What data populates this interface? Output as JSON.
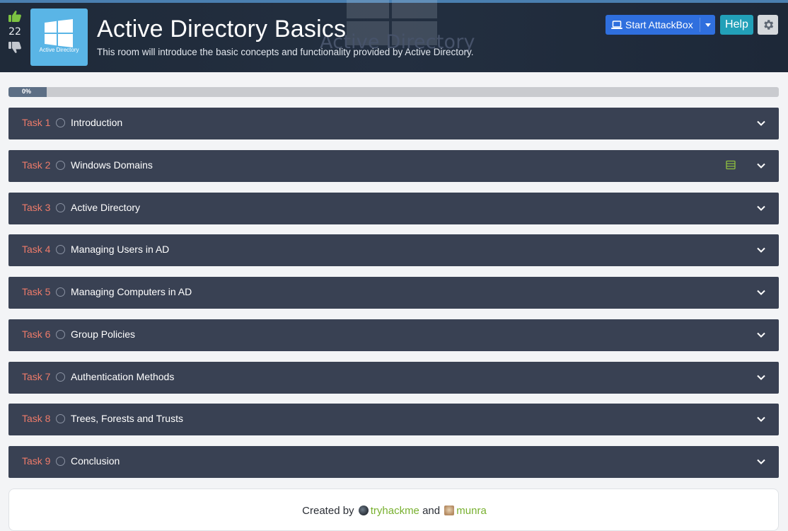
{
  "header": {
    "title": "Active Directory Basics",
    "subtitle": "This room will introduce the basic concepts and functionality provided by Active Directory.",
    "background_text": "Active Directory",
    "vote_count": "22",
    "logo_caption": "Active Directory",
    "attackbox_label": "Start AttackBox",
    "help_label": "Help"
  },
  "progress": {
    "label": "0%",
    "value": 0
  },
  "tasks": [
    {
      "num": "Task 1",
      "name": "Introduction"
    },
    {
      "num": "Task 2",
      "name": "Windows Domains",
      "has_questions_icon": true
    },
    {
      "num": "Task 3",
      "name": "Active Directory"
    },
    {
      "num": "Task 4",
      "name": "Managing Users in AD"
    },
    {
      "num": "Task 5",
      "name": "Managing Computers in AD"
    },
    {
      "num": "Task 6",
      "name": "Group Policies"
    },
    {
      "num": "Task 7",
      "name": "Authentication Methods"
    },
    {
      "num": "Task 8",
      "name": "Trees, Forests and Trusts"
    },
    {
      "num": "Task 9",
      "name": "Conclusion"
    }
  ],
  "footer": {
    "created_by": "Created by",
    "and": "and",
    "author1": "tryhackme",
    "author2": "munra"
  },
  "icons": {
    "thumbs_up": "thumbs-up-icon",
    "thumbs_down": "thumbs-down-icon",
    "laptop": "laptop-icon",
    "gear": "gear-icon",
    "chevron": "chevron-down-icon",
    "questions": "list-icon",
    "task_status": "circle-icon"
  },
  "colors": {
    "header_bg": "#1f2a39",
    "task_bg": "#394153",
    "task_num": "#ee7b6a",
    "attackbox": "#2f6fde",
    "help": "#22a0b8",
    "author_link": "#78b02f",
    "thumbs_up": "#7cc242"
  }
}
